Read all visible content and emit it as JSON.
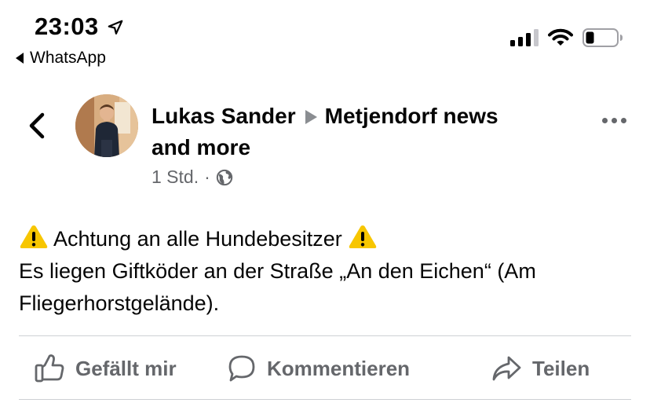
{
  "status_bar": {
    "time": "23:03",
    "back_app": "WhatsApp"
  },
  "post": {
    "author": "Lukas Sander",
    "group_line1": "Metjendorf news",
    "group_line2": "and more",
    "time": "1 Std.",
    "separator": "·",
    "body_line1": "Achtung an alle Hundebesitzer",
    "body_line2": "Es liegen Giftköder an der Straße „An den Eichen“ (Am",
    "body_line3": "Fliegerhorstgelände)."
  },
  "actions": {
    "like": "Gefällt mir",
    "comment": "Kommentieren",
    "share": "Teilen"
  },
  "colors": {
    "text": "#050505",
    "secondary": "#65676b",
    "divider": "#ced0d4",
    "warning": "#f7c600"
  },
  "icons": [
    "location-arrow-icon",
    "back-triangle-icon",
    "signal-icon",
    "wifi-icon",
    "battery-icon",
    "chevron-left-icon",
    "globe-icon",
    "more-icon",
    "warning-icon",
    "like-icon",
    "comment-icon",
    "share-icon"
  ]
}
